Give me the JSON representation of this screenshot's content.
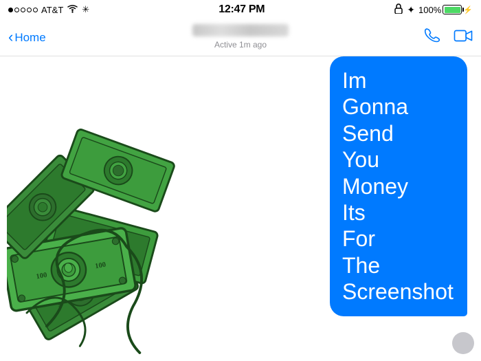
{
  "statusBar": {
    "carrier": "AT&T",
    "time": "12:47 PM",
    "battery": "100%",
    "wifiIcon": "wifi",
    "bluetoothIcon": "bluetooth",
    "lockIcon": "lock"
  },
  "navBar": {
    "backLabel": "Home",
    "activeStatus": "Active 1m ago",
    "chevronRight": "›"
  },
  "messageBubble": {
    "text": "Im\nGonna\nSend\nYou\nMoney\nIts\nFor\nThe\nScreenshot"
  },
  "icons": {
    "phone": "phone-icon",
    "video": "video-icon",
    "back": "back-chevron-icon"
  }
}
